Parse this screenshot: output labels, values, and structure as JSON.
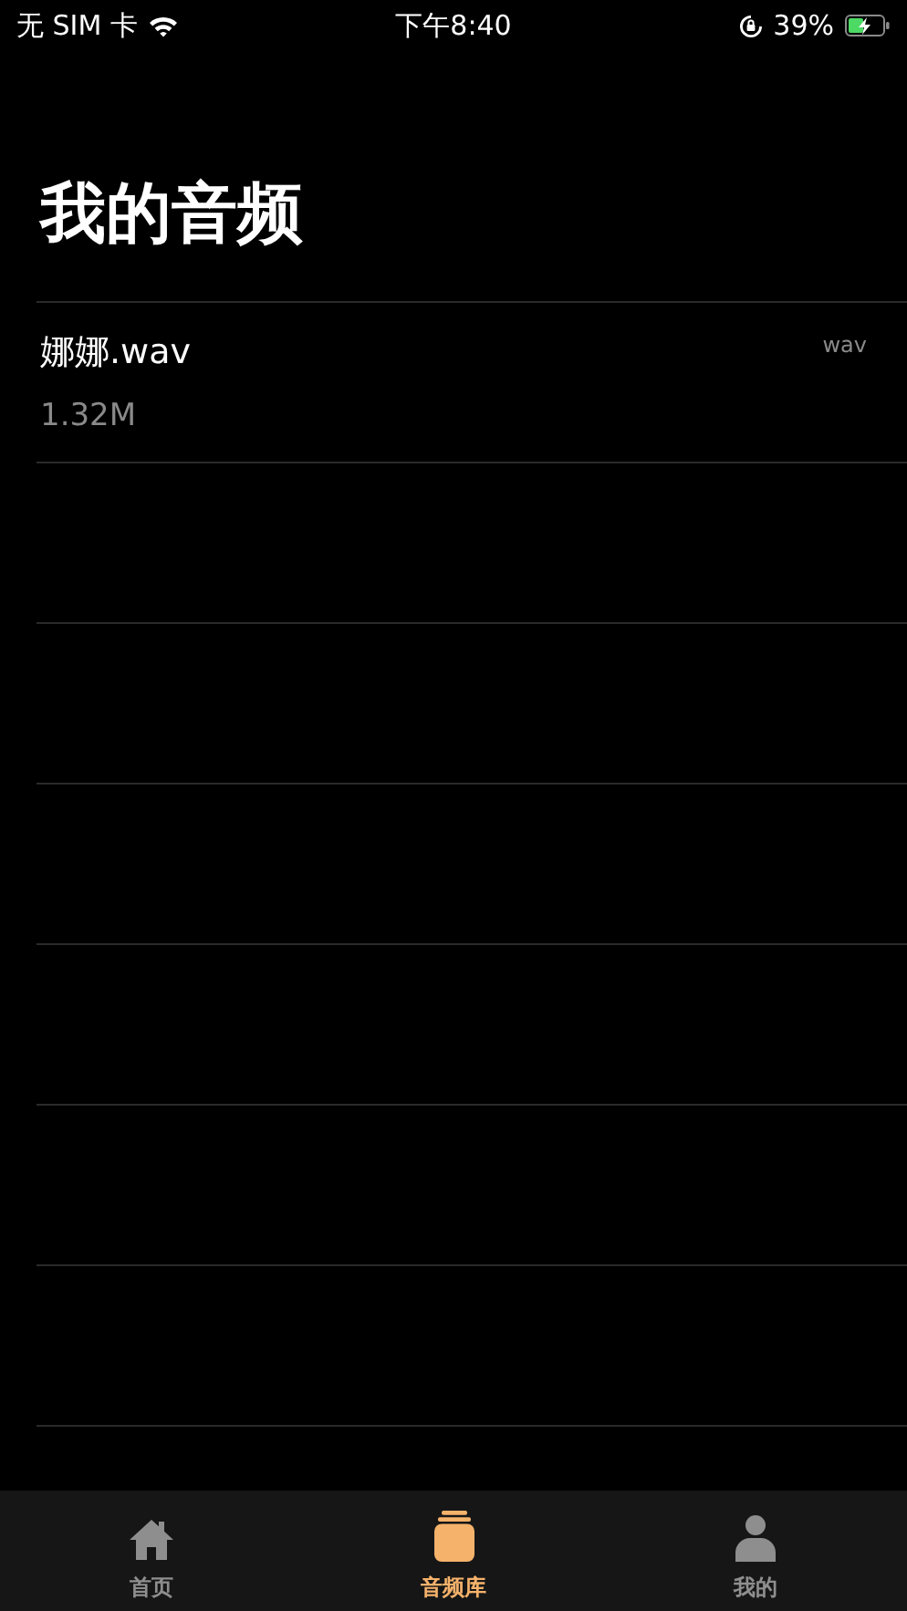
{
  "status_bar": {
    "carrier": "无 SIM 卡",
    "time": "下午8:40",
    "battery": "39%"
  },
  "title": "我的音频",
  "files": [
    {
      "name": "娜娜.wav",
      "size": "1.32M",
      "format": "wav"
    }
  ],
  "tab_bar": [
    {
      "label": "首页",
      "selected": false
    },
    {
      "label": "音频库",
      "selected": true
    },
    {
      "label": "我的",
      "selected": false
    }
  ]
}
